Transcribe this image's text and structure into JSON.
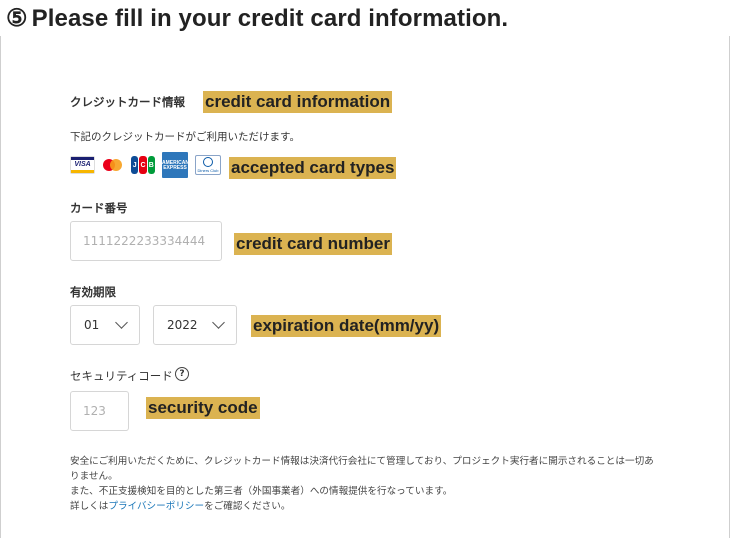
{
  "heading": {
    "number": "⑤",
    "text": "Please fill in your credit card information."
  },
  "section": {
    "title": "クレジットカード情報",
    "annotation": "credit card information"
  },
  "cards_note": "下記のクレジットカードがご利用いただけます。",
  "cards": {
    "annotation": "accepted card types",
    "items": [
      {
        "name": "visa-icon",
        "label": "VISA"
      },
      {
        "name": "mastercard-icon",
        "label": ""
      },
      {
        "name": "jcb-icon",
        "label": "JCB"
      },
      {
        "name": "amex-icon",
        "label": "AMERICAN EXPRESS"
      },
      {
        "name": "diners-icon",
        "label": "Diners Club"
      }
    ],
    "colors": {
      "visa": "#1a1f71",
      "mastercard_red": "#eb001b",
      "mastercard_orange": "#f79e1b",
      "amex": "#2e77bb"
    }
  },
  "card_number": {
    "label": "カード番号",
    "placeholder": "1111222233334444",
    "value": "",
    "annotation": "credit card number"
  },
  "expiry": {
    "label": "有効期限",
    "month": "01",
    "year": "2022",
    "annotation": "expiration date(mm/yy)"
  },
  "security": {
    "label": "セキュリティコード",
    "help_icon": "?",
    "placeholder": "123",
    "value": "",
    "annotation": "security code"
  },
  "fine_print": {
    "line1": "安全にご利用いただくために、クレジットカード情報は決済代行会社にて管理しており、プロジェクト実行者に開示されることは一切あ",
    "line2": "りません。",
    "line3": "また、不正支援検知を目的とした第三者（外国事業者）への情報提供を行なっています。",
    "line4_prefix": "詳しくは",
    "line4_link": "プライバシーポリシー",
    "line4_suffix": "をご確認ください。"
  },
  "colors": {
    "annotation_highlight": "#dbb351",
    "link": "#1a76b8"
  }
}
